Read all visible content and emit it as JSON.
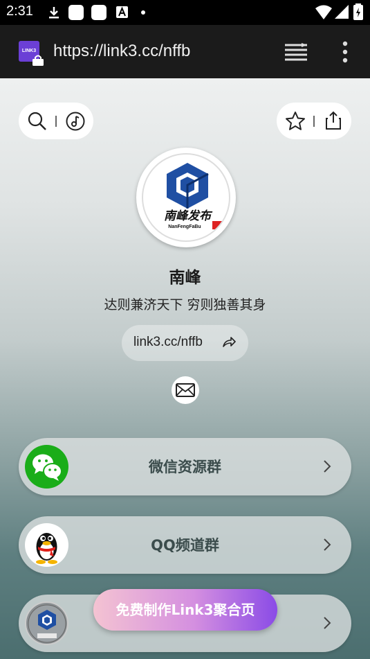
{
  "status_bar": {
    "time": "2:31"
  },
  "browser": {
    "url": "https://link3.cc/nffb",
    "site_icon_text": "LINK3"
  },
  "profile": {
    "name": "南峰",
    "bio": "达则兼济天下 穷则独善其身",
    "link": "link3.cc/nffb",
    "avatar_text": "南峰发布",
    "avatar_subtext": "NanFengFaBu"
  },
  "cards": [
    {
      "label": "微信资源群",
      "icon": "wechat-icon"
    },
    {
      "label": "QQ频道群",
      "icon": "qq-penguin-icon"
    },
    {
      "label": "",
      "icon": "nffb-logo-icon"
    }
  ],
  "cta": {
    "label": "免费制作Link3聚合页"
  },
  "colors": {
    "wechat_green": "#1aad19",
    "cta_start": "#f4c3d2",
    "cta_end": "#8a4be6"
  }
}
